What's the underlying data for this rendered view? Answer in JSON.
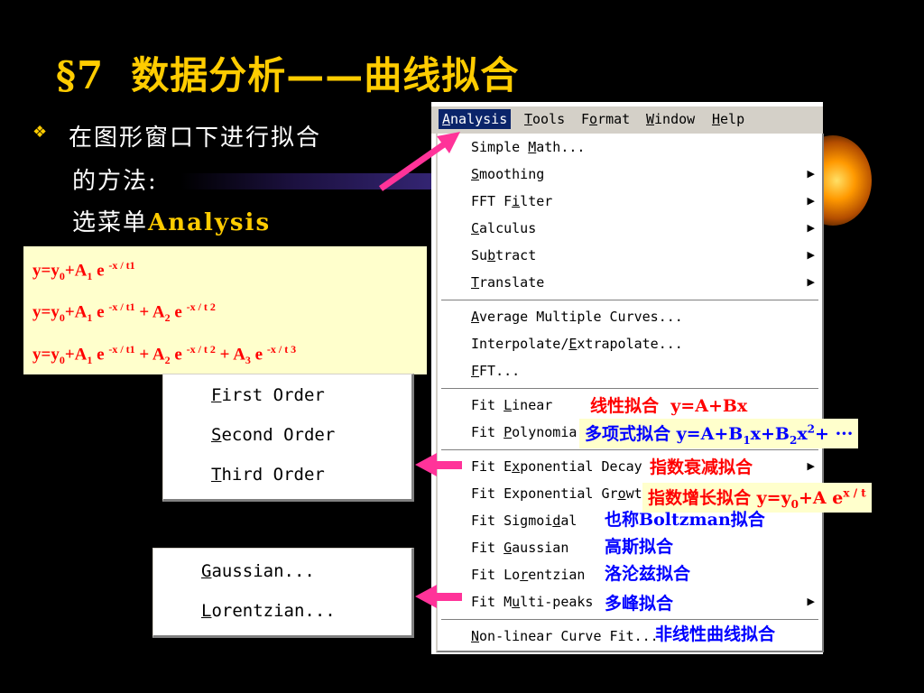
{
  "title": {
    "section": "§7",
    "main": "数据分析——曲线拟合"
  },
  "left_text": {
    "bullet": "❖",
    "line1": "在图形窗口下进行拟合",
    "line2": "的方法:",
    "line3_prefix": "选菜单",
    "line3_keyword": "Analysis"
  },
  "formulas": {
    "f1": {
      "y": "y=y",
      "y_sub": "0",
      "a1": "+A",
      "a1_sub": "1",
      "e1": " e ",
      "e1_sup": "-x / t1"
    },
    "f2": {
      "y": "y=y",
      "y_sub": "0",
      "a1": "+A",
      "a1_sub": "1",
      "e1": " e ",
      "e1_sup": "-x / t1",
      "a2": " + A",
      "a2_sub": "2",
      "e2": " e ",
      "e2_sup": "-x / t 2"
    },
    "f3": {
      "y": "y=y",
      "y_sub": "0",
      "a1": "+A",
      "a1_sub": "1",
      "e1": " e ",
      "e1_sup": "-x / t1",
      "a2": " + A",
      "a2_sub": "2",
      "e2": " e ",
      "e2_sup": "-x / t 2",
      "a3": " + A",
      "a3_sub": "3",
      "e3": " e ",
      "e3_sup": "-x / t 3"
    }
  },
  "polynomial_submenu": {
    "items": [
      {
        "mnemonic": "F",
        "rest": "irst Order"
      },
      {
        "mnemonic": "S",
        "rest": "econd Order"
      },
      {
        "mnemonic": "T",
        "rest": "hird Order"
      }
    ]
  },
  "peaks_submenu": {
    "items": [
      {
        "mnemonic": "G",
        "rest": "aussian..."
      },
      {
        "mnemonic": "L",
        "rest": "orentzian..."
      }
    ]
  },
  "menubar": {
    "analysis": {
      "mnemonic": "A",
      "rest": "nalysis"
    },
    "tools": {
      "mnemonic": "T",
      "rest": "ools"
    },
    "format": {
      "pre": "F",
      "mnemonic": "o",
      "rest": "rmat"
    },
    "window": {
      "mnemonic": "W",
      "rest": "indow"
    },
    "help": {
      "mnemonic": "H",
      "rest": "elp"
    }
  },
  "menu": {
    "simple_math": {
      "pre": "Simple ",
      "mnemonic": "M",
      "rest": "ath..."
    },
    "smoothing": {
      "pre": "",
      "mnemonic": "S",
      "rest": "moothing"
    },
    "fft_filter": {
      "pre": "FFT F",
      "mnemonic": "i",
      "rest": "lter"
    },
    "calculus": {
      "pre": "",
      "mnemonic": "C",
      "rest": "alculus"
    },
    "subtract": {
      "pre": "Su",
      "mnemonic": "b",
      "rest": "tract"
    },
    "translate": {
      "pre": "",
      "mnemonic": "T",
      "rest": "ranslate"
    },
    "average": {
      "pre": "",
      "mnemonic": "A",
      "rest": "verage Multiple Curves..."
    },
    "interpolate": {
      "pre": "Interpolate/",
      "mnemonic": "E",
      "rest": "xtrapolate..."
    },
    "fft": {
      "pre": "",
      "mnemonic": "F",
      "rest": "FT..."
    },
    "fit_linear": {
      "pre": "Fit ",
      "mnemonic": "L",
      "rest": "inear"
    },
    "fit_polynomial": {
      "pre": "Fit ",
      "mnemonic": "P",
      "rest": "olynomia"
    },
    "fit_exp_decay": {
      "pre": "Fit E",
      "mnemonic": "x",
      "rest": "ponential Decay"
    },
    "fit_exp_growth": {
      "pre": "Fit Exponential Gr",
      "mnemonic": "o",
      "rest": "wt"
    },
    "fit_sigmoidal": {
      "pre": "Fit Sigmoi",
      "mnemonic": "d",
      "rest": "al"
    },
    "fit_gaussian": {
      "pre": "Fit ",
      "mnemonic": "G",
      "rest": "aussian"
    },
    "fit_lorentzian": {
      "pre": "Fit Lo",
      "mnemonic": "r",
      "rest": "entzian"
    },
    "fit_multipeaks": {
      "pre": "Fit M",
      "mnemonic": "u",
      "rest": "lti-peaks"
    },
    "nonlinear": {
      "pre": "",
      "mnemonic": "N",
      "rest": "on-linear Curve Fit..."
    },
    "submenu_arrow": "▶"
  },
  "annotations": {
    "linear": {
      "cn": "线性拟合",
      "eq": "y=A+Bx"
    },
    "poly": {
      "cn": "多项式拟合 ",
      "eq_a": "y=A+B",
      "eq_a_sub": "1",
      "eq_b": "x+B",
      "eq_b_sub": "2",
      "eq_c": "x",
      "eq_c_sup": "2",
      "eq_d": "+ ···"
    },
    "decay": "指数衰减拟合",
    "growth": {
      "cn": "指数增长拟合 ",
      "eq_a": "y=y",
      "eq_a_sub": "0",
      "eq_b": "+A e",
      "eq_b_sup": "x / t"
    },
    "sigmoidal": {
      "cn_a": "也称",
      "en": "Boltzman",
      "cn_b": "拟合"
    },
    "gaussian": "高斯拟合",
    "lorentzian": "洛沦兹拟合",
    "multipeaks": "多峰拟合",
    "nonlinear": "非线性曲线拟合"
  },
  "colors": {
    "title": "#ffcc00",
    "formula_bg": "#ffffcc",
    "formula_text": "#ff0000",
    "menu_highlight": "#0a246a",
    "arrow": "#ff3399",
    "annotation_blue": "#0000ff",
    "annotation_red": "#ff0000"
  }
}
